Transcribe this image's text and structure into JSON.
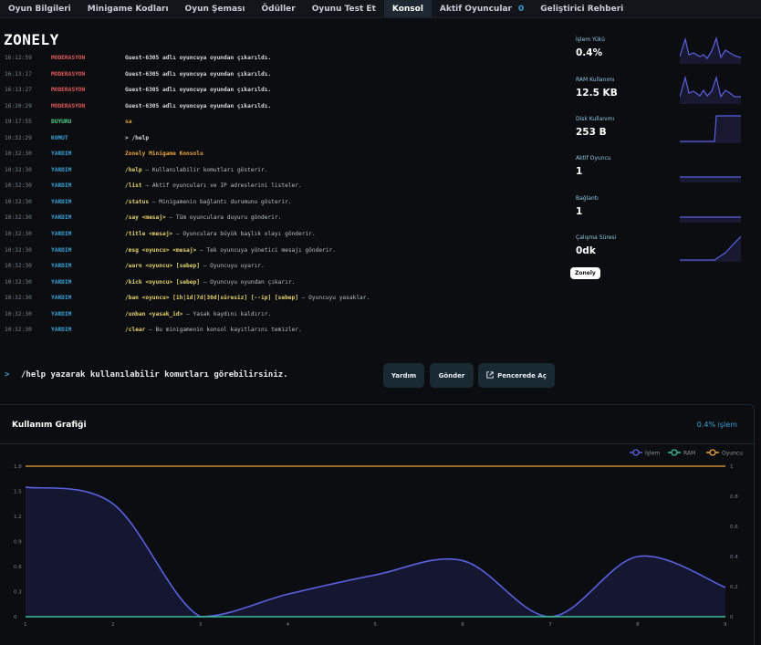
{
  "tabs": [
    {
      "label": "Oyun Bilgileri"
    },
    {
      "label": "Minigame Kodları"
    },
    {
      "label": "Oyun Şeması"
    },
    {
      "label": "Ödüller"
    },
    {
      "label": "Oyunu Test Et"
    },
    {
      "label": "Konsol",
      "active": true
    },
    {
      "label": "Aktif Oyuncular",
      "count": "0"
    },
    {
      "label": "Geliştirici Rehberi"
    }
  ],
  "console": {
    "title": "ZONELY",
    "logs": [
      {
        "time": "16:12:59",
        "level": "MODERASYON",
        "message": "Guest-6305 adlı oyuncuya oyundan çıkarıldı."
      },
      {
        "time": "16:13:17",
        "level": "MODERASYON",
        "message": "Guest-6305 adlı oyuncuya oyundan çıkarıldı."
      },
      {
        "time": "16:13:27",
        "level": "MODERASYON",
        "message": "Guest-6305 adlı oyuncuya oyundan çıkarıldı."
      },
      {
        "time": "16:20:29",
        "level": "MODERASYON",
        "message": "Guest-6305 adlı oyuncuya oyundan çıkarıldı."
      },
      {
        "time": "19:17:55",
        "level": "DUYURU",
        "message": "sa"
      },
      {
        "time": "10:32:29",
        "level": "KOMUT",
        "message": "> /help"
      },
      {
        "time": "10:32:30",
        "level": "YARDIM",
        "message": "Zonely Minigame Konsolu"
      },
      {
        "time": "10:32:30",
        "level": "YARDIM",
        "cmd": "/help",
        "desc": " – Kullanılabilir komutları gösterir."
      },
      {
        "time": "10:32:30",
        "level": "YARDIM",
        "cmd": "/list",
        "desc": " – Aktif oyuncuları ve IP adreslerini listeler."
      },
      {
        "time": "10:32:30",
        "level": "YARDIM",
        "cmd": "/status",
        "desc": " – Minigamenin bağlantı durumunu gösterir."
      },
      {
        "time": "10:32:30",
        "level": "YARDIM",
        "cmd": "/say <mesaj>",
        "desc": " – Tüm oyunculara duyuru gönderir."
      },
      {
        "time": "10:32:30",
        "level": "YARDIM",
        "cmd": "/title <mesaj>",
        "desc": " – Oyunculara büyük başlık olayı gönderir."
      },
      {
        "time": "10:32:30",
        "level": "YARDIM",
        "cmd": "/msg <oyuncu> <mesaj>",
        "desc": " – Tek oyuncuya yönetici mesajı gönderir."
      },
      {
        "time": "10:32:30",
        "level": "YARDIM",
        "cmd": "/warn <oyuncu> [sebep]",
        "desc": " – Oyuncuyu uyarır."
      },
      {
        "time": "10:32:30",
        "level": "YARDIM",
        "cmd": "/kick <oyuncu> [sebep]",
        "desc": " – Oyuncuyu oyundan çıkarır."
      },
      {
        "time": "10:32:30",
        "level": "YARDIM",
        "cmd": "/ban <oyuncu> [1h|1d|7d|30d|süresiz] [--ip] [sebep]",
        "desc": " – Oyuncuyu yasaklar."
      },
      {
        "time": "10:32:30",
        "level": "YARDIM",
        "cmd": "/unban <yasak_id>",
        "desc": " – Yasak kaydını kaldırır."
      },
      {
        "time": "10:32:30",
        "level": "YARDIM",
        "cmd": "/clear",
        "desc": " – Bu minigamenin konsol kayıtlarını temizler."
      }
    ],
    "level_colors": {
      "MODERASYON": "#e05a5a",
      "DUYURU": "#4fd18b",
      "KOMUT": "#3aa1d6",
      "YARDIM": "#3aa1d6"
    },
    "prompt": ">",
    "input_value": "/help yazarak kullanılabilir komutları görebilirsiniz.",
    "buttons": {
      "help": "Yardım",
      "send": "Gönder",
      "popout": "Pencerede Aç"
    }
  },
  "stats": [
    {
      "label": "İşlem Yükü",
      "value": "0.4%"
    },
    {
      "label": "RAM Kullanımı",
      "value": "12.5 KB"
    },
    {
      "label": "Disk Kullanımı",
      "value": "253 B"
    },
    {
      "label": "Aktif Oyuncu",
      "value": "1"
    },
    {
      "label": "Bağlantı",
      "value": "1"
    },
    {
      "label": "Çalışma Süresi",
      "value": "0dk"
    }
  ],
  "server_badge": "Zonely",
  "chart_panel": {
    "title": "Kullanım Grafiği",
    "summary": "0.4% işlem"
  },
  "chart_data": {
    "type": "line",
    "x": [
      1,
      2,
      3,
      4,
      5,
      6,
      7,
      8,
      9
    ],
    "series": [
      {
        "name": "İşlem",
        "axis": "left",
        "color": "#5a60e0",
        "values": [
          1.55,
          1.35,
          0.0,
          0.27,
          0.5,
          0.67,
          0.0,
          0.72,
          0.35
        ]
      },
      {
        "name": "RAM",
        "axis": "left",
        "color": "#3bbf9a",
        "values": [
          0,
          0,
          0,
          0,
          0,
          0,
          0,
          0,
          0
        ]
      },
      {
        "name": "Oyuncu",
        "axis": "right",
        "color": "#e6a23c",
        "values": [
          1,
          1,
          1,
          1,
          1,
          1,
          1,
          1,
          1
        ]
      }
    ],
    "y_left": {
      "ticks": [
        "0",
        "0.3",
        "0.6",
        "0.9",
        "1.2",
        "1.5",
        "1.8"
      ],
      "range": [
        0,
        1.8
      ]
    },
    "y_right": {
      "ticks": [
        "0",
        "0.2",
        "0.4",
        "0.6",
        "0.8",
        "1"
      ],
      "range": [
        0,
        1
      ]
    },
    "x_ticks": [
      "1",
      "2",
      "3",
      "4",
      "5",
      "6",
      "7",
      "8",
      "9"
    ],
    "legend_position": "top-right",
    "grid": false
  }
}
